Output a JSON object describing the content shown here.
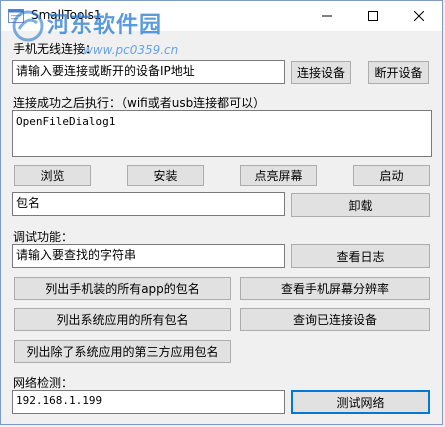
{
  "window": {
    "title": "SmallTools1",
    "watermark": "河东软件园",
    "watermark_url": "www.pc0359.cn"
  },
  "connect": {
    "label": "手机无线连接：",
    "ip_placeholder": "请输入要连接或断开的设备IP地址",
    "connect_button": "连接设备",
    "disconnect_button": "断开设备"
  },
  "after_connect": {
    "label": "连接成功之后执行：（wifi或者usb连接都可以）",
    "command_value": "OpenFileDialog1",
    "browse_button": "浏览",
    "install_button": "安装",
    "wake_button": "点亮屏幕",
    "launch_button": "启动"
  },
  "package": {
    "value": "包名",
    "uninstall_button": "卸载"
  },
  "debug": {
    "label": "调试功能：",
    "search_placeholder": "请输入要查找的字符串",
    "view_log_button": "查看日志",
    "list_all_packages_button": "列出手机装的所有app的包名",
    "view_resolution_button": "查看手机屏幕分辨率",
    "list_system_packages_button": "列出系统应用的所有包名",
    "query_connected_button": "查询已连接设备",
    "list_third_party_button": "列出除了系统应用的第三方应用包名"
  },
  "network": {
    "label": "网络检测：",
    "ip_value": "192.168.1.199",
    "test_button": "测试网络"
  }
}
